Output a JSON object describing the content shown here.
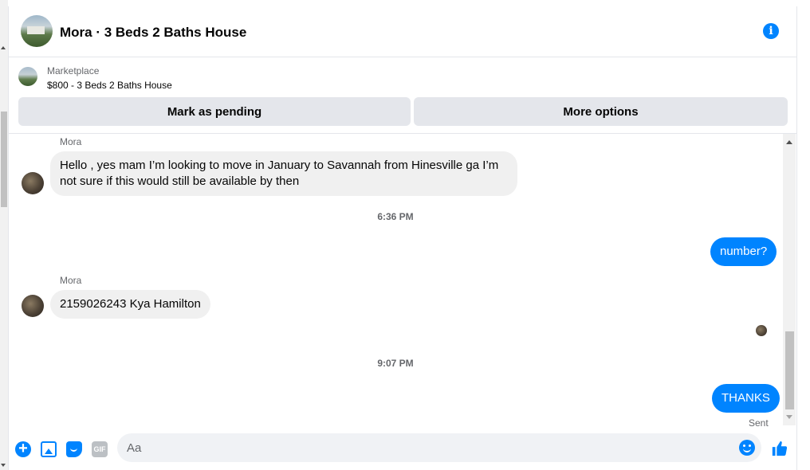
{
  "header": {
    "title": "Mora · 3 Beds 2 Baths House",
    "info_icon": "info-icon",
    "accent_color": "#0084ff"
  },
  "listing": {
    "label": "Marketplace",
    "title": "$800 - 3 Beds 2 Baths House",
    "actions": {
      "pending_label": "Mark as pending",
      "more_label": "More options"
    }
  },
  "messages": {
    "first": {
      "sender": "Mora",
      "text": "Hello , yes mam I’m looking to move in January to Savannah from Hinesville ga I’m not sure if this would still be available by then"
    },
    "time1": "6:36 PM",
    "outgoing1": "number?",
    "second": {
      "sender": "Mora",
      "text": "2159026243 Kya Hamilton"
    },
    "time2": "9:07 PM",
    "outgoing2": "THANKS",
    "status": "Sent"
  },
  "composer": {
    "placeholder": "Aa",
    "value": "",
    "icons": [
      "plus-icon",
      "photo-icon",
      "sticker-icon",
      "gif-icon",
      "emoji-icon",
      "like-icon"
    ],
    "gif_label": "GIF"
  }
}
